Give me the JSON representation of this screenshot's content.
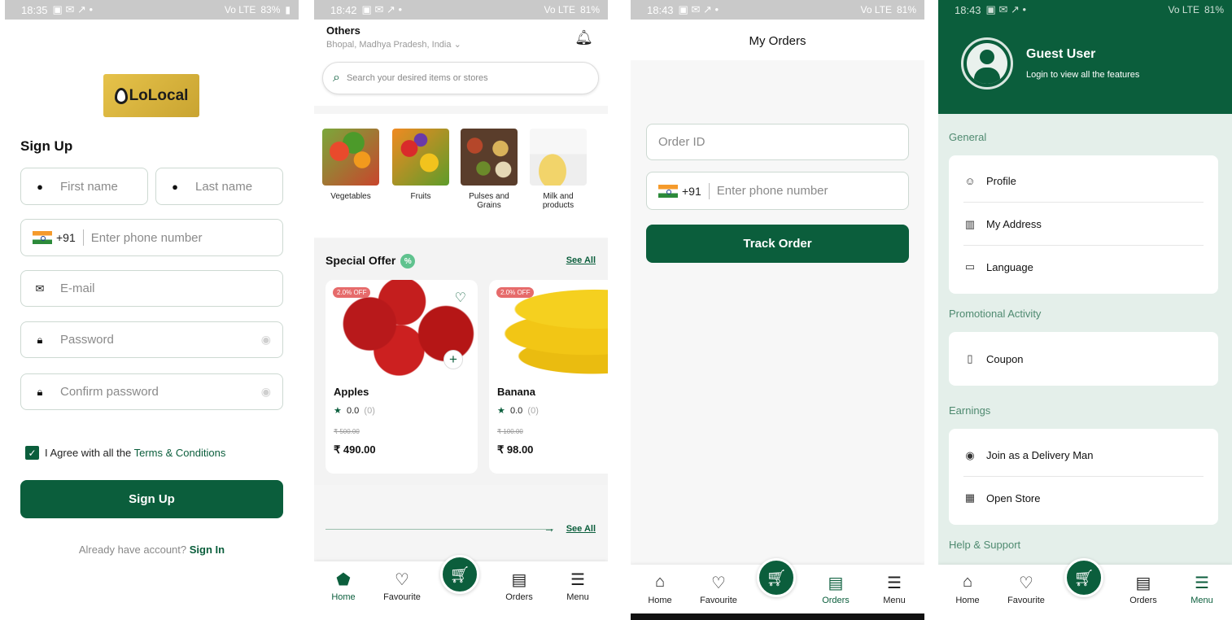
{
  "status": {
    "s1": {
      "time": "18:35",
      "battery": "83%",
      "network": "Vo LTE"
    },
    "s2": {
      "time": "18:42",
      "battery": "81%",
      "network": "Vo LTE"
    },
    "s3": {
      "time": "18:43",
      "battery": "81%",
      "network": "Vo LTE"
    },
    "s4": {
      "time": "18:43",
      "battery": "81%",
      "network": "Vo LTE"
    }
  },
  "signup": {
    "logo_text": "LoLocal",
    "title": "Sign Up",
    "first_name_placeholder": "First name",
    "last_name_placeholder": "Last name",
    "country_code": "+91",
    "phone_placeholder": "Enter phone number",
    "email_placeholder": "E-mail",
    "password_placeholder": "Password",
    "confirm_password_placeholder": "Confirm password",
    "agree_prefix": "I Agree with all the",
    "terms_link": "Terms & Conditions",
    "signup_button": "Sign Up",
    "already_text": "Already have account?",
    "signin_link": "Sign In"
  },
  "home": {
    "location_title": "Others",
    "location_sub": "Bhopal, Madhya Pradesh, India",
    "search_placeholder": "Search your desired items or stores",
    "categories": [
      {
        "label": "Vegetables"
      },
      {
        "label": "Fruits"
      },
      {
        "label": "Pulses and Grains"
      },
      {
        "label": "Milk and products"
      }
    ],
    "special_offer_title": "Special Offer",
    "see_all": "See All",
    "see_all_2": "See All",
    "products": [
      {
        "badge": "2.0% OFF",
        "name": "Apples",
        "rating": "0.0",
        "count": "(0)",
        "old_price": "₹ 500.00",
        "price": "₹ 490.00"
      },
      {
        "badge": "2.0% OFF",
        "name": "Banana",
        "rating": "0.0",
        "count": "(0)",
        "old_price": "₹ 100.00",
        "price": "₹ 98.00"
      }
    ]
  },
  "nav": {
    "home": "Home",
    "favourite": "Favourite",
    "orders": "Orders",
    "menu": "Menu"
  },
  "orders": {
    "title": "My Orders",
    "order_id_placeholder": "Order ID",
    "country_code": "+91",
    "phone_placeholder": "Enter phone number",
    "track_button": "Track Order"
  },
  "menu": {
    "guest_name": "Guest User",
    "guest_sub": "Login to view all the features",
    "general": "General",
    "profile": "Profile",
    "address": "My Address",
    "language": "Language",
    "promo": "Promotional Activity",
    "coupon": "Coupon",
    "earnings": "Earnings",
    "delivery": "Join as a Delivery Man",
    "store": "Open Store",
    "help": "Help & Support"
  },
  "colors": {
    "brand": "#0b5e3c",
    "accent": "#5fc28e",
    "badge": "#e66b6b"
  }
}
